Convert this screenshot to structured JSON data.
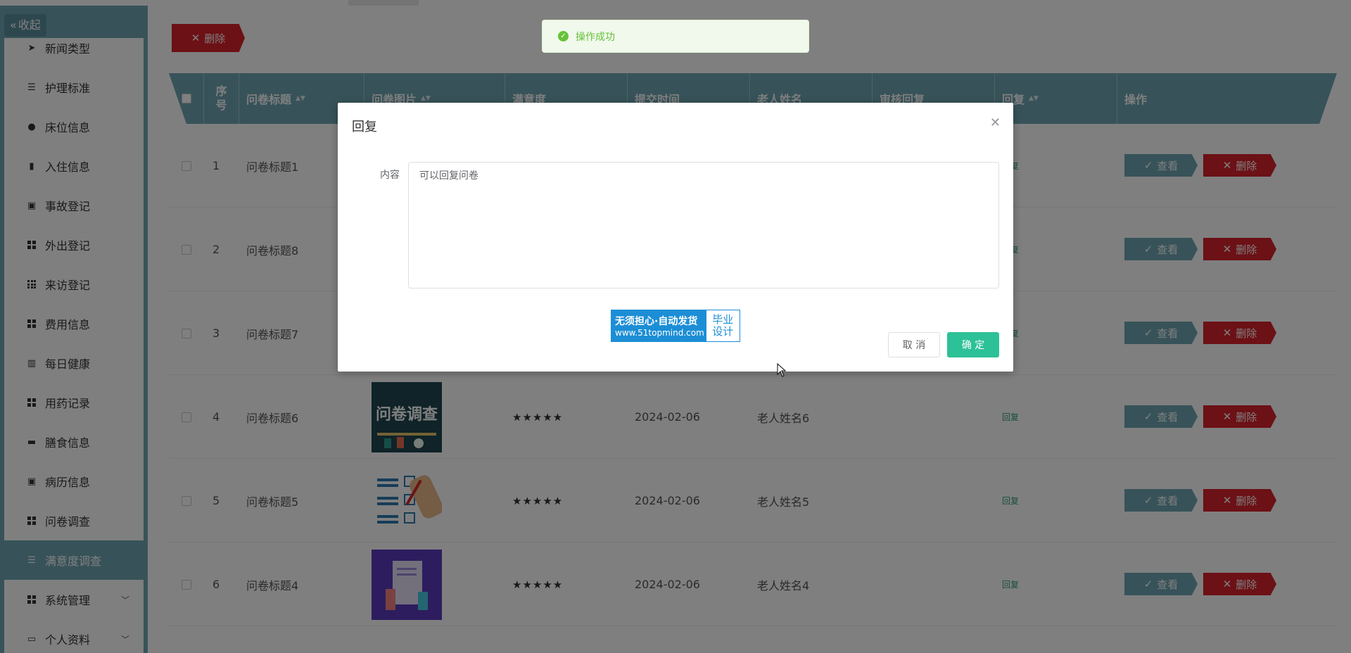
{
  "sidebar": {
    "collapse_label": "收起",
    "items": [
      {
        "label": "新闻类型",
        "icon": "send-icon"
      },
      {
        "label": "护理标准",
        "icon": "list-icon"
      },
      {
        "label": "床位信息",
        "icon": "user-icon"
      },
      {
        "label": "入住信息",
        "icon": "bar-chart-icon"
      },
      {
        "label": "事故登记",
        "icon": "clipboard-icon"
      },
      {
        "label": "外出登记",
        "icon": "grid-icon"
      },
      {
        "label": "来访登记",
        "icon": "grid-nine-icon"
      },
      {
        "label": "费用信息",
        "icon": "grid-icon"
      },
      {
        "label": "每日健康",
        "icon": "building-icon"
      },
      {
        "label": "用药记录",
        "icon": "grid-icon"
      },
      {
        "label": "膳食信息",
        "icon": "monitor-icon"
      },
      {
        "label": "病历信息",
        "icon": "clipboard-check-icon"
      },
      {
        "label": "问卷调查",
        "icon": "grid-icon"
      },
      {
        "label": "满意度调查",
        "icon": "list-icon",
        "active": true
      },
      {
        "label": "系统管理",
        "icon": "grid-icon",
        "expandable": true
      },
      {
        "label": "个人资料",
        "icon": "id-card-icon",
        "expandable": true
      }
    ]
  },
  "toolbar": {
    "delete_label": "删除"
  },
  "table": {
    "headers": [
      "序号",
      "问卷标题",
      "问卷图片",
      "满意度",
      "提交时间",
      "老人姓名",
      "审核回复",
      "回复",
      "操作"
    ],
    "rows": [
      {
        "index": "1",
        "title": "问卷标题1",
        "rating": "",
        "date": "",
        "name": "",
        "reply": "回复",
        "thumb": "none"
      },
      {
        "index": "2",
        "title": "问卷标题8",
        "rating": "",
        "date": "",
        "name": "",
        "reply": "回复",
        "thumb": "none"
      },
      {
        "index": "3",
        "title": "问卷标题7",
        "rating": "",
        "date": "",
        "name": "",
        "reply": "回复",
        "thumb": "none"
      },
      {
        "index": "4",
        "title": "问卷标题6",
        "rating": "★★★★★",
        "date": "2024-02-06",
        "name": "老人姓名6",
        "reply": "回复",
        "thumb": "survey-poster"
      },
      {
        "index": "5",
        "title": "问卷标题5",
        "rating": "★★★★★",
        "date": "2024-02-06",
        "name": "老人姓名5",
        "reply": "回复",
        "thumb": "checklist"
      },
      {
        "index": "6",
        "title": "问卷标题4",
        "rating": "★★★★★",
        "date": "2024-02-06",
        "name": "老人姓名4",
        "reply": "回复",
        "thumb": "document-purple"
      }
    ],
    "view_label": "查看",
    "delete_label": "删除",
    "thumb_text": "问卷调查"
  },
  "toast": {
    "message": "操作成功"
  },
  "dialog": {
    "title": "回复",
    "field_label": "内容",
    "field_value": "可以回复问卷",
    "cancel_label": "取 消",
    "ok_label": "确 定"
  },
  "watermark": {
    "line1": "无须担心·自动发货",
    "line2": "www.51topmind.com",
    "right1": "毕业",
    "right2": "设计"
  },
  "colors": {
    "primary": "#6fa6b3",
    "danger": "#d9232d",
    "success": "#2dc197",
    "toast_green": "#67c23a"
  }
}
